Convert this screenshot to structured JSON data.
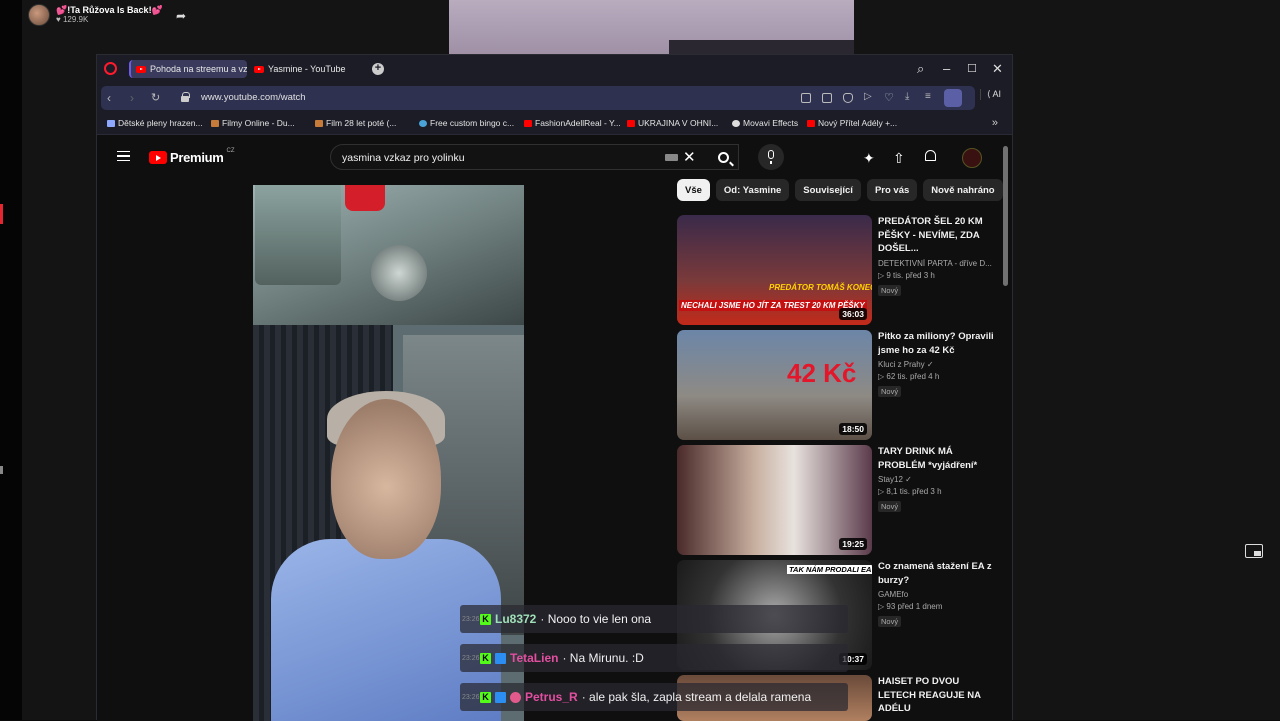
{
  "streamer": {
    "title": "💕!Ta Růžova Is Back!💕",
    "viewers": "129.9K"
  },
  "browser": {
    "tabs": [
      {
        "label": "Pohoda na streemu a vzk"
      },
      {
        "label": "Yasmine - YouTube"
      }
    ],
    "url": "www.youtube.com/watch",
    "ai_label": "AI",
    "bookmarks": [
      "Dětské pleny hrazen...",
      "Filmy Online - Du...",
      "Film 28 let poté (...",
      "Free custom bingo c...",
      "FashionAdellReal - Y...",
      "UKRAJINA V OHNI...",
      "Movavi Effects",
      "Nový Přítel Adély +..."
    ]
  },
  "youtube": {
    "logo": "Premium",
    "region": "CZ",
    "search_query": "yasmina vzkaz pro yolinku",
    "chips": [
      "Vše",
      "Od: Yasmine",
      "Související",
      "Pro vás",
      "Nově nahráno"
    ],
    "recommendations": [
      {
        "title": "PREDÁTOR ŠEL 20 KM PĚŠKY - NEVÍME, ZDA DOŠEL...",
        "channel": "DETEKTIVNÍ PARTA - dříve D...",
        "stats": "9 tis.  před 3 h",
        "badge": "Nový",
        "duration": "36:03",
        "caption_top": "PREDÁTOR TOMÁŠ KONEČNÝ",
        "caption_bottom": "NECHALI JSME HO JÍT ZA TREST 20 KM PĚŠKY"
      },
      {
        "title": "Pitko za miliony? Opravili jsme ho za 42 Kč",
        "channel": "Kluci z Prahy",
        "stats": "62 tis.  před 4 h",
        "badge": "Nový",
        "duration": "18:50",
        "caption_top": "42 Kč",
        "caption_bottom": ""
      },
      {
        "title": "TARY DRINK MÁ PROBLÉM *vyjádření*",
        "channel": "Stay12",
        "stats": "8,1 tis.  před 3 h",
        "badge": "Nový",
        "duration": "19:25",
        "caption_top": "",
        "caption_bottom": ""
      },
      {
        "title": "Co znamená stažení EA z burzy?",
        "channel": "GAMEfo",
        "stats": "93  před 1 dnem",
        "badge": "Nový",
        "duration": "10:37",
        "caption_top": "TAK NÁM PRODALI EA",
        "caption_bottom": ""
      },
      {
        "title": "HAISET PO DVOU LETECH REAGUJE NA ADÉLU",
        "channel": "",
        "stats": "",
        "badge": "",
        "duration": "",
        "caption_top": "",
        "caption_bottom": ""
      }
    ]
  },
  "chat": [
    {
      "time": "23:26",
      "user": "Lu8372",
      "message": "Nooo to vie len ona",
      "color": "#9fe0b8"
    },
    {
      "time": "23:26",
      "user": "TetaLien",
      "message": "Na Mirunu. :D",
      "color": "#e34fa0"
    },
    {
      "time": "23:26",
      "user": "Petrus_R",
      "message": "ale pak šla, zapla stream a delala ramena",
      "color": "#e34fa0"
    }
  ]
}
